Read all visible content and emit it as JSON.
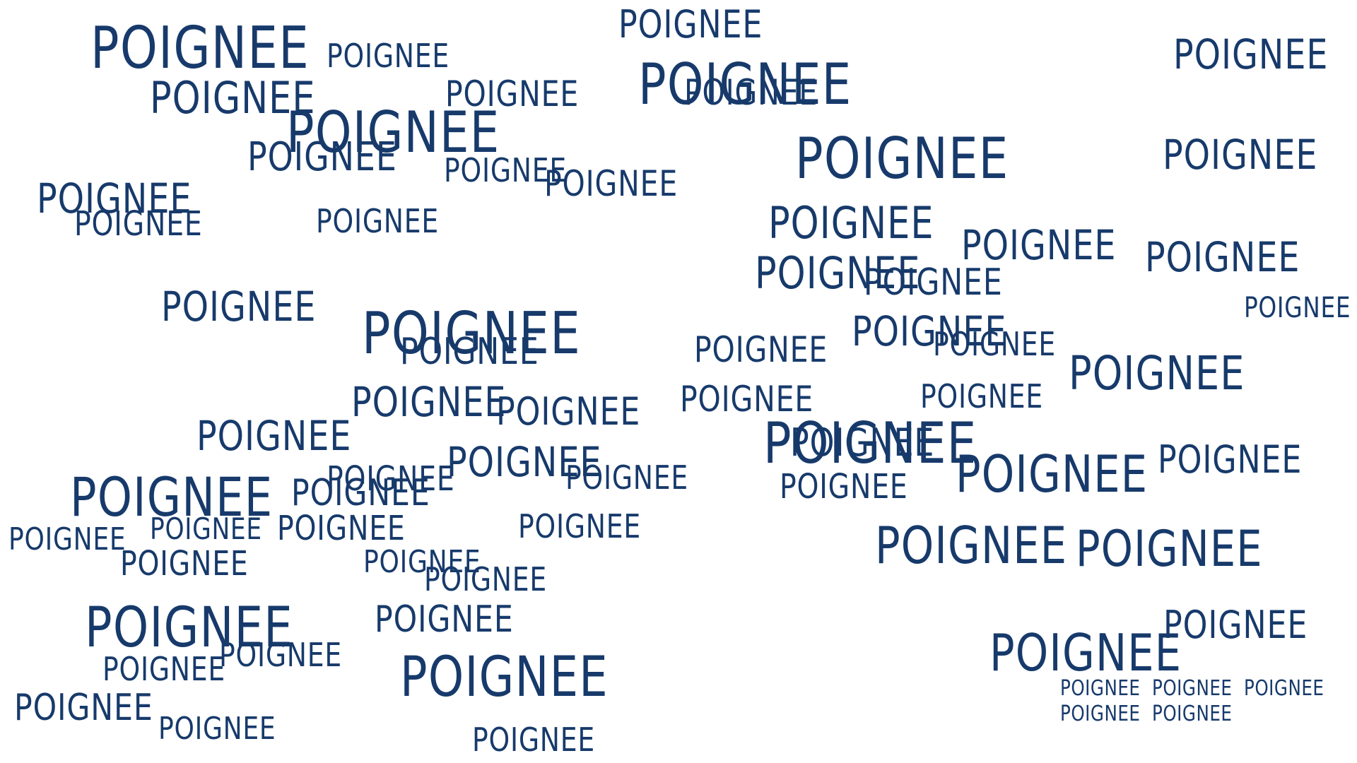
{
  "ink_color": "#173a6b",
  "background_color": "#ffffff",
  "words": [
    "POIGNEE",
    "POIGNEE",
    "POIGNEE",
    "POIGNEE",
    "POIGNEE",
    "POIGNEE",
    "POIGNEE",
    "POIGNEE",
    "POIGNEE",
    "POIGNEE",
    "POIGNEE",
    "POIGNEE",
    "POIGNEE",
    "POIGNEE",
    "POIGNEE",
    "POIGNEE",
    "POIGNEE",
    "POIGNEE",
    "POIGNEE",
    "POIGNEE",
    "POIGNEE",
    "POIGNEE",
    "POIGNEE",
    "POIGNEE",
    "POIGNEE",
    "POIGNEE",
    "POIGNEE",
    "POIGNEE",
    "POIGNEE",
    "POIGNEE",
    "POIGNEE",
    "POIGNEE",
    "POIGNEE",
    "POIGNEE",
    "POIGNEE",
    "POIGNEE",
    "POIGNEE",
    "POIGNEE",
    "POIGNEE",
    "POIGNEE",
    "POIGNEE",
    "POIGNEE",
    "POIGNEE",
    "POIGNEE",
    "POIGNEE",
    "POIGNEE",
    "POIGNEE",
    "POIGNEE",
    "POIGNEE",
    "POIGNEE",
    "POIGNEE",
    "POIGNEE",
    "POIGNEE",
    "POIGNEE",
    "POIGNEE",
    "POIGNEE",
    "POIGNEE",
    "POIGNEE",
    "POIGNEE",
    "POIGNEE",
    "POIGNEE",
    "POIGNEE",
    "POIGNEE",
    "POIGNEE",
    "POIGNEE",
    "POIGNEE",
    "POIGNEE",
    "POIGNEE",
    "POIGNEE"
  ]
}
